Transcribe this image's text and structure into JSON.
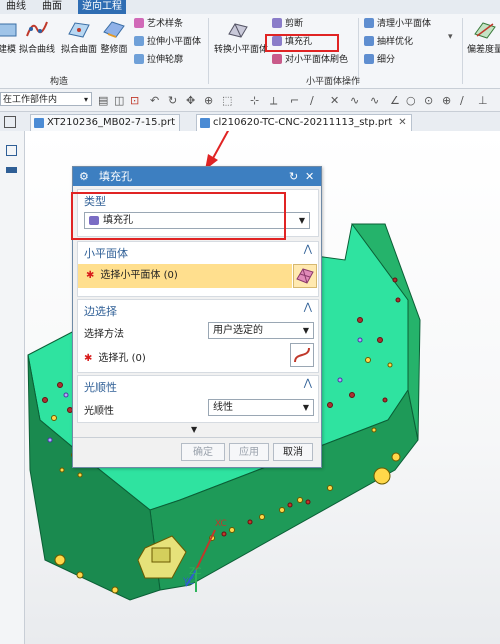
{
  "ribbon": {
    "tabs": [
      "曲线",
      "曲面",
      "逆向工程"
    ],
    "active_tab": "逆向工程",
    "left_buttons": [
      "建模",
      "拟合曲线",
      "拟合曲面",
      "整修面"
    ],
    "small_col1": [
      "艺术样条",
      "拉伸小平面体",
      "拉伸轮廓"
    ],
    "group1": "构造",
    "convert_button": "转换小平面体",
    "small_col2": [
      "剪断",
      "填充孔",
      "对小平面体刷色"
    ],
    "group2": "小平面体操作",
    "small_col3": [
      "清理小平面体",
      "抽样优化",
      "细分"
    ],
    "right_button": "偏差度量"
  },
  "toolbar": {
    "filter_value": "在工作部件内"
  },
  "doc_tabs": [
    {
      "label": "XT210236_MB02-7-15.prt"
    },
    {
      "label": "cl210620-TC-CNC-20211113_stp.prt"
    }
  ],
  "dialog": {
    "title": "填充孔",
    "type_section": {
      "header": "类型",
      "value": "填充孔"
    },
    "facet_section": {
      "header": "小平面体",
      "select_label": "选择小平面体 (0)"
    },
    "edge_section": {
      "header": "边选择",
      "method_label": "选择方法",
      "method_value": "用户选定的",
      "hole_label": "选择孔 (0)"
    },
    "smooth_section": {
      "header": "光顺性",
      "label": "光顺性",
      "value": "线性"
    },
    "buttons": {
      "ok": "确定",
      "apply": "应用",
      "cancel": "取消"
    }
  },
  "axes": {
    "x": "XC",
    "y": "YC",
    "z": "ZC"
  },
  "colors": {
    "accent": "#3d7fc1",
    "highlight": "#e02424",
    "model_top": "#2fe3a0",
    "model_side": "#1e9a58",
    "select_bg": "#ffdf8e"
  }
}
